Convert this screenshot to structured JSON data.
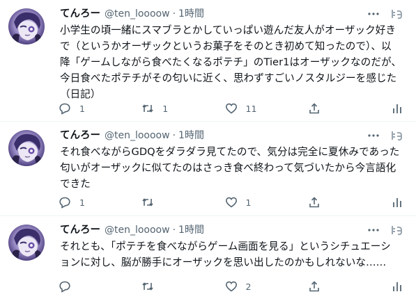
{
  "tweets": [
    {
      "display_name": "てんろー",
      "handle": "@ten_loooow",
      "separator": "·",
      "time": "1時間",
      "lines": [
        "小学生の頃一緒にスマブラとかしていっぱい遊んだ友人がオーザック好き",
        "で（というかオーザックというお菓子をそのとき初めて知ったので）、以",
        "降「ゲームしながら食べたくなるポテチ」のTier1はオーザックなのだが、",
        "今日食べたポテチがその匂いに近く、思わずすごいノスタルジーを感じた",
        "（日記）"
      ],
      "reply_count": "1",
      "retweet_count": "1",
      "like_count": "11"
    },
    {
      "display_name": "てんろー",
      "handle": "@ten_loooow",
      "separator": "·",
      "time": "1時間",
      "lines": [
        "それ食べながらGDQをダラダラ見てたので、気分は完全に夏休みであった",
        "匂いがオーザックに似てたのはさっき食べ終わって気づいたから今言語化",
        "できた"
      ],
      "reply_count": "1",
      "retweet_count": "",
      "like_count": "1"
    },
    {
      "display_name": "てんろー",
      "handle": "@ten_loooow",
      "separator": "·",
      "time": "1時間",
      "lines": [
        "それとも、「ポテチを食べながらゲーム画面を見る」というシチュエーシ",
        "ョンに対し、脳が勝手にオーザックを思い出したのかもしれないな……"
      ],
      "reply_count": "",
      "retweet_count": "",
      "like_count": "2"
    }
  ],
  "icons": {
    "more": "more-dots-icon",
    "client": "tweetdeck-tg-icon",
    "reply": "reply-bubble-icon",
    "retweet": "retweet-icon",
    "like": "heart-icon",
    "share": "analytics-icon"
  },
  "colors": {
    "text": "#0f1419",
    "secondary": "#536471",
    "divider": "#eff3f4"
  }
}
